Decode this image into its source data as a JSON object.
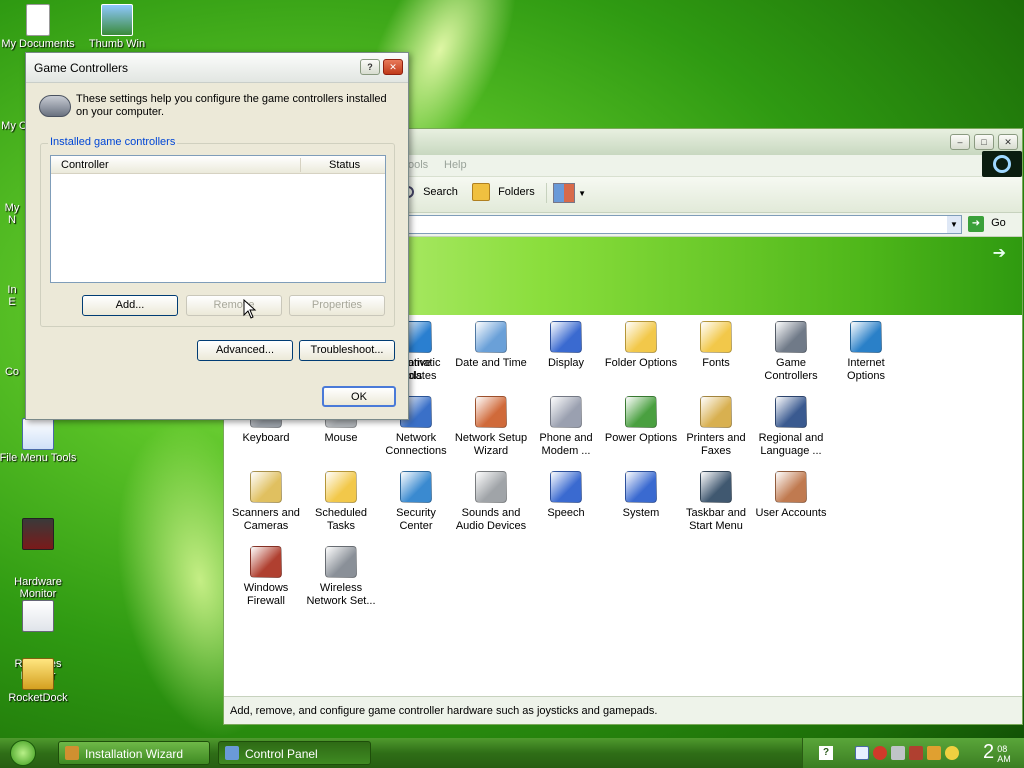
{
  "desktop": {
    "icons": [
      {
        "label": "My Documents"
      },
      {
        "label": "Thumb Win"
      },
      {
        "label": "File Menu Tools"
      },
      {
        "label": "Hardware\nMonitor"
      },
      {
        "label": "Resoures\nHacker"
      },
      {
        "label": "RocketDock"
      }
    ],
    "partial_labels": [
      "My C",
      "My\nN",
      "In\nE",
      "Co"
    ]
  },
  "explorer": {
    "menu": [
      "ools",
      "Help"
    ],
    "toolbar": {
      "search_label": "Search",
      "folders_label": "Folders"
    },
    "address": {
      "go_label": "Go"
    },
    "items": [
      {
        "label": "istrative\nools",
        "icon": "admin-tools-icon",
        "color": "#8a8aa0"
      },
      {
        "label": "Automatic\nUpdates",
        "icon": "globe-icon",
        "color": "#2a7fd0"
      },
      {
        "label": "Date and Time",
        "icon": "calendar-clock-icon",
        "color": "#6aa0d8"
      },
      {
        "label": "Display",
        "icon": "monitor-icon",
        "color": "#3a6ad0"
      },
      {
        "label": "Folder Options",
        "icon": "folder-icon",
        "color": "#f2c84a"
      },
      {
        "label": "Fonts",
        "icon": "fonts-folder-icon",
        "color": "#f2c84a"
      },
      {
        "label": "Game\nControllers",
        "icon": "gamepad-icon",
        "color": "#707a88"
      },
      {
        "label": "Internet\nOptions",
        "icon": "globe-check-icon",
        "color": "#2a80c8"
      },
      {
        "label": "Keyboard",
        "icon": "keyboard-icon",
        "color": "#9aa0a8"
      },
      {
        "label": "Mouse",
        "icon": "mouse-icon",
        "color": "#b0b4b8"
      },
      {
        "label": "Network\nConnections",
        "icon": "network-icon",
        "color": "#3a70c8"
      },
      {
        "label": "Network Setup\nWizard",
        "icon": "house-network-icon",
        "color": "#d06a3a"
      },
      {
        "label": "Phone and\nModem ...",
        "icon": "phone-icon",
        "color": "#9aa0b0"
      },
      {
        "label": "Power Options",
        "icon": "power-icon",
        "color": "#4aa040"
      },
      {
        "label": "Printers and\nFaxes",
        "icon": "printer-icon",
        "color": "#d8b050"
      },
      {
        "label": "Regional and\nLanguage ...",
        "icon": "user-globe-icon",
        "color": "#3a5a90"
      },
      {
        "label": "Scanners and\nCameras",
        "icon": "scanner-icon",
        "color": "#e0c060"
      },
      {
        "label": "Scheduled\nTasks",
        "icon": "clock-folder-icon",
        "color": "#f2c84a"
      },
      {
        "label": "Security\nCenter",
        "icon": "shield-icon",
        "color": "#3a8ad0"
      },
      {
        "label": "Sounds and\nAudio Devices",
        "icon": "speaker-icon",
        "color": "#a0a4a8"
      },
      {
        "label": "Speech",
        "icon": "speech-icon",
        "color": "#3a6ad0"
      },
      {
        "label": "System",
        "icon": "system-icon",
        "color": "#3a6ad0"
      },
      {
        "label": "Taskbar and\nStart Menu",
        "icon": "taskbar-icon",
        "color": "#405870"
      },
      {
        "label": "User Accounts",
        "icon": "users-icon",
        "color": "#c07a50"
      },
      {
        "label": "Windows\nFirewall",
        "icon": "firewall-icon",
        "color": "#b04030"
      },
      {
        "label": "Wireless\nNetwork Set...",
        "icon": "wireless-icon",
        "color": "#8a9098"
      }
    ],
    "status": "Add, remove, and configure game controller hardware such as joysticks and gamepads."
  },
  "dialog": {
    "title": "Game Controllers",
    "description": "These settings help you configure the game controllers installed on your computer.",
    "group_label": "Installed game controllers",
    "columns": [
      "Controller",
      "Status"
    ],
    "buttons": {
      "add": "Add...",
      "remove": "Remove",
      "properties": "Properties",
      "advanced": "Advanced...",
      "troubleshoot": "Troubleshoot...",
      "ok": "OK"
    }
  },
  "taskbar": {
    "tasks": [
      "Installation Wizard",
      "Control Panel"
    ],
    "clock_hour": "2",
    "clock_min": "08",
    "clock_ampm": "AM"
  }
}
